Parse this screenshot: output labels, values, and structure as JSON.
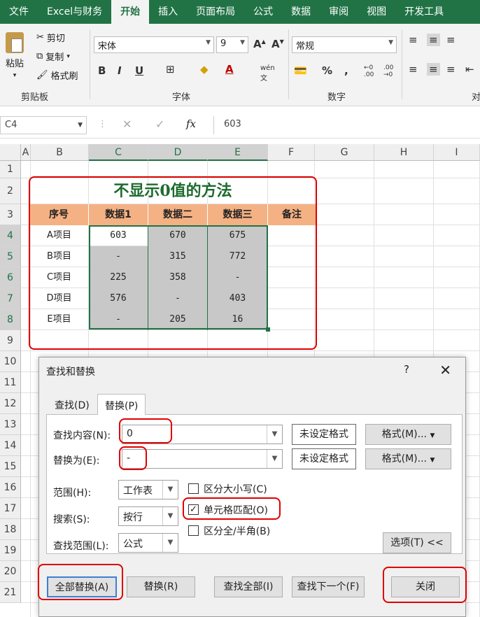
{
  "ribbon_tabs": [
    "文件",
    "Excel与财务",
    "开始",
    "插入",
    "页面布局",
    "公式",
    "数据",
    "审阅",
    "视图",
    "开发工具"
  ],
  "active_tab": "开始",
  "clipboard": {
    "paste": "粘贴",
    "cut": "剪切",
    "copy": "复制",
    "format_painter": "格式刷",
    "group": "剪贴板"
  },
  "font": {
    "name": "宋体",
    "size": "9",
    "grow": "A",
    "shrink": "A",
    "bold": "B",
    "italic": "I",
    "underline": "U",
    "group": "字体"
  },
  "number": {
    "format": "常规",
    "percent": "%",
    "comma": ",",
    "group": "数字"
  },
  "align_group_partial": "对",
  "formula_bar": {
    "name_box": "C4",
    "fx": "fx",
    "content": "603"
  },
  "columns": [
    "A",
    "B",
    "C",
    "D",
    "E",
    "F",
    "G",
    "H",
    "I"
  ],
  "rows": [
    "1",
    "2",
    "3",
    "4",
    "5",
    "6",
    "7",
    "8",
    "9",
    "10",
    "11",
    "12",
    "13",
    "14",
    "15",
    "16",
    "17",
    "18",
    "19",
    "20",
    "21"
  ],
  "sheet": {
    "title": "不显示0值的方法",
    "headers": [
      "序号",
      "数据1",
      "数据二",
      "数据三",
      "备注"
    ],
    "data": [
      [
        "A项目",
        "603",
        "670",
        "675",
        ""
      ],
      [
        "B项目",
        "-",
        "315",
        "772",
        ""
      ],
      [
        "C项目",
        "225",
        "358",
        "-",
        ""
      ],
      [
        "D项目",
        "576",
        "-",
        "403",
        ""
      ],
      [
        "E项目",
        "-",
        "205",
        "16",
        ""
      ]
    ]
  },
  "dialog": {
    "title": "查找和替换",
    "help": "?",
    "close": "✕",
    "tab_find": "查找(D)",
    "tab_replace": "替换(P)",
    "find_label": "查找内容(N):",
    "find_value": "0",
    "replace_label": "替换为(E):",
    "replace_value": "-",
    "no_format_1": "未设定格式",
    "no_format_2": "未设定格式",
    "format_btn_1": "格式(M)...",
    "format_btn_2": "格式(M)...",
    "scope_label": "范围(H):",
    "scope_value": "工作表",
    "search_label": "搜索(S):",
    "search_value": "按行",
    "lookin_label": "查找范围(L):",
    "lookin_value": "公式",
    "match_case": "区分大小写(C)",
    "match_cell": "单元格匹配(O)",
    "match_width": "区分全/半角(B)",
    "match_case_checked": false,
    "match_cell_checked": true,
    "match_width_checked": false,
    "options_btn": "选项(T) <<",
    "replace_all": "全部替换(A)",
    "replace": "替换(R)",
    "find_all": "查找全部(I)",
    "find_next": "查找下一个(F)",
    "close_btn": "关闭"
  },
  "colors": {
    "excel_green": "#217346",
    "header_orange": "#f4b183",
    "highlight_red": "#e00000",
    "title_green": "#1e6a2e"
  }
}
